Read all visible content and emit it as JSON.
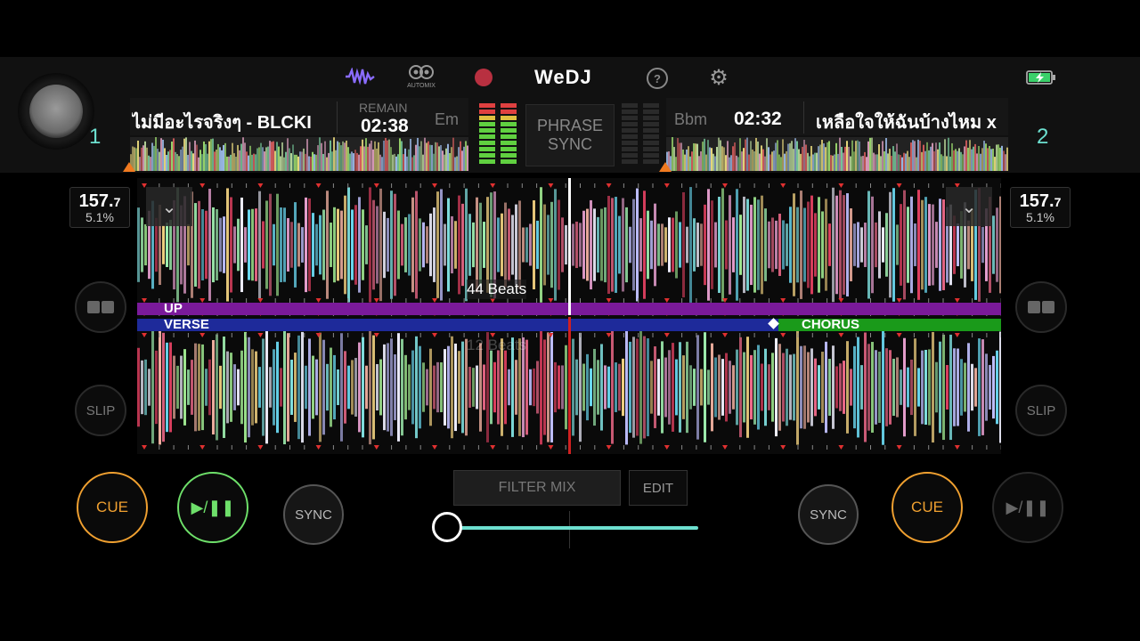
{
  "app": {
    "name": "WeDJ"
  },
  "toolbar": {
    "waveform_icon": "waveform-icon",
    "automix_label": "AUTOMIX",
    "record_icon": "record-icon",
    "help_icon": "help-icon",
    "settings_icon": "gear-icon",
    "battery_icon": "battery-charging-icon"
  },
  "deck1": {
    "number": "1",
    "title": "ไม่มีอะไรจริงๆ - BLCKI",
    "remain_label": "REMAIN",
    "time": "02:38",
    "key": "Em",
    "bpm_main": "157.",
    "bpm_decimal": "7",
    "pitch": "5.1%",
    "cue_label": "CUE",
    "play_label": "▶/❚❚",
    "sync_label": "SYNC",
    "slip_label": "SLIP"
  },
  "deck2": {
    "number": "2",
    "key": "Bbm",
    "time": "02:32",
    "title": "เหลือใจให้ฉันบ้างไหม x",
    "bpm_main": "157.",
    "bpm_decimal": "7",
    "pitch": "5.1%",
    "cue_label": "CUE",
    "play_label": "▶/❚❚",
    "sync_label": "SYNC",
    "slip_label": "SLIP"
  },
  "center": {
    "phrase_sync_line1": "PHRASE",
    "phrase_sync_line2": "SYNC",
    "filter_mix_label": "FILTER MIX",
    "edit_label": "EDIT",
    "crossfader_value": 0
  },
  "waveform": {
    "deck1_beats": "44 Beats",
    "deck2_beats": "12 Beats",
    "deck1_phrase": "UP",
    "deck2_phrase_a": "VERSE",
    "deck2_phrase_b": "CHORUS"
  },
  "colors": {
    "accent_cyan": "#6de0d0",
    "cue_orange": "#f0a030",
    "play_green": "#6ee06a",
    "phrase_purple": "#7a1a9a",
    "verse_blue": "#1e2a9a",
    "chorus_green": "#1a9a1a",
    "playhead_red": "#d02020"
  }
}
